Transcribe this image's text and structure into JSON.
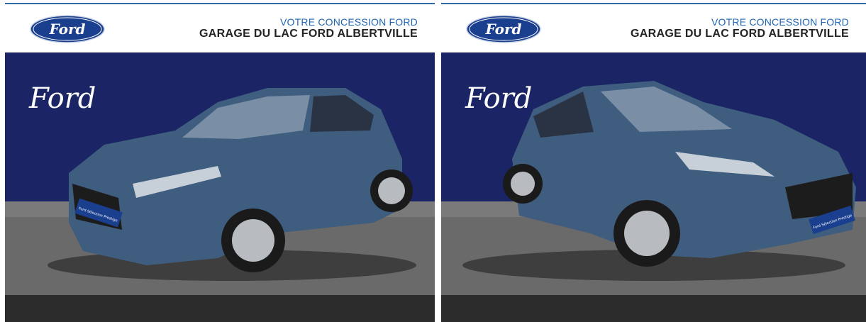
{
  "listings": [
    {
      "header": {
        "dealer_kicker": "VOTRE CONCESSION FORD",
        "dealer_name": "GARAGE DU LAC FORD ALBERTVILLE",
        "logo_text": "Ford"
      },
      "photo": {
        "backdrop_script": "Ford",
        "subject": "car-front-left-view",
        "plate_text": "Ford Sélection Prestige"
      }
    },
    {
      "header": {
        "dealer_kicker": "VOTRE CONCESSION FORD",
        "dealer_name": "GARAGE DU LAC FORD ALBERTVILLE",
        "logo_text": "Ford"
      },
      "photo": {
        "backdrop_script": "Ford",
        "subject": "car-front-right-view",
        "plate_text": "Ford Sélection Prestige"
      }
    }
  ],
  "colors": {
    "backdrop_navy": "#1b2565",
    "floor_gray": "#6a6a6a",
    "car_blue": "#3f5d7e",
    "ford_blue": "#1a3f8f",
    "link_blue": "#1f66b4",
    "footer_dark": "#2c2c2c"
  }
}
